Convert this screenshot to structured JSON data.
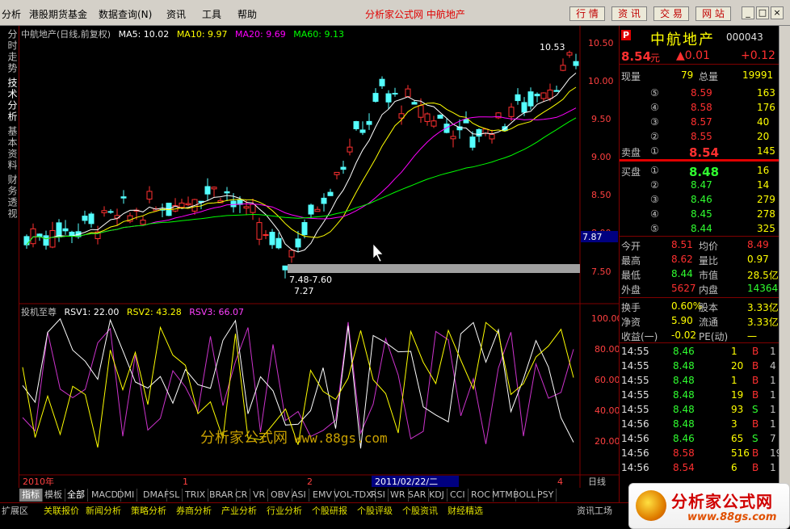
{
  "menu": {
    "items": [
      "分析",
      "港股期货基金",
      "数据查询(N)",
      "资讯",
      "工具",
      "帮助"
    ],
    "title": "分析家公式网  中航地产",
    "buttons": [
      "行 情",
      "资 讯",
      "交 易",
      "网 站"
    ],
    "win_buttons": [
      "_",
      "□",
      "×"
    ]
  },
  "side_tabs": [
    "分时走势",
    "技术分析",
    "基本资料",
    "财务透视"
  ],
  "main_chart": {
    "header": {
      "name": "中航地产(日线,前复权)",
      "ma5": "MA5: 10.02",
      "ma10": "MA10: 9.97",
      "ma20": "MA20: 9.69",
      "ma60": "MA60: 9.13"
    },
    "price_axis": [
      "10.50",
      "10.00",
      "9.50",
      "9.00",
      "8.50",
      "8.00",
      "7.50"
    ],
    "current_marker": "7.87",
    "annot_high": "10.53",
    "annot_range": "7.48-7.60",
    "annot_low": "7.27"
  },
  "indicator": {
    "header": {
      "name": "投机至尊",
      "rsv1": "RSV1: 22.00",
      "rsv2": "RSV2: 43.28",
      "rsv3": "RSV3: 66.07"
    },
    "axis": [
      "100.00",
      "80.00",
      "60.00",
      "40.00",
      "20.00"
    ]
  },
  "time_axis": {
    "year": "2010年",
    "m1": "1",
    "m2": "2",
    "date": "2011/02/22/二",
    "m4": "4",
    "period": "日线"
  },
  "watermark": {
    "cn": "分析家公式网",
    "url": "www.88gs.com"
  },
  "right_panel": {
    "title": "中航地产",
    "code": "000043",
    "badge": "P",
    "price": "8.54",
    "price_unit": "元",
    "change": "▲0.01",
    "change_pct": "+0.12",
    "volume_now_label": "现量",
    "volume_now": "79",
    "volume_total_label": "总量",
    "volume_total": "19991",
    "sell_label": "卖盘",
    "buy_label": "买盘",
    "sells": [
      {
        "lvl": "⑤",
        "price": "8.59",
        "vol": "163"
      },
      {
        "lvl": "④",
        "price": "8.58",
        "vol": "176"
      },
      {
        "lvl": "③",
        "price": "8.57",
        "vol": "40"
      },
      {
        "lvl": "②",
        "price": "8.55",
        "vol": "20"
      },
      {
        "lvl": "①",
        "price": "8.54",
        "vol": "145"
      }
    ],
    "buys": [
      {
        "lvl": "①",
        "price": "8.48",
        "vol": "16"
      },
      {
        "lvl": "②",
        "price": "8.47",
        "vol": "14"
      },
      {
        "lvl": "③",
        "price": "8.46",
        "vol": "279"
      },
      {
        "lvl": "④",
        "price": "8.45",
        "vol": "278"
      },
      {
        "lvl": "⑤",
        "price": "8.44",
        "vol": "325"
      }
    ],
    "stats": [
      {
        "l1": "今开",
        "v1": "8.51",
        "l2": "均价",
        "v2": "8.49"
      },
      {
        "l1": "最高",
        "v1": "8.62",
        "l2": "量比",
        "v2": "0.97"
      },
      {
        "l1": "最低",
        "v1": "8.44",
        "l2": "市值",
        "v2": "28.5亿"
      },
      {
        "l1": "外盘",
        "v1": "5627",
        "l2": "内盘",
        "v2": "14364"
      }
    ],
    "fund": [
      {
        "l1": "换手",
        "v1": "0.60%",
        "l2": "股本",
        "v2": "3.33亿"
      },
      {
        "l1": "净资",
        "v1": "5.90",
        "l2": "流通",
        "v2": "3.33亿"
      },
      {
        "l1": "收益(一)",
        "v1": "-0.02",
        "l2": "PE(动)",
        "v2": "一"
      }
    ],
    "ticks": [
      {
        "t": "14:55",
        "p": "8.46",
        "v": "1",
        "s": "B",
        "n": "1"
      },
      {
        "t": "14:55",
        "p": "8.48",
        "v": "20",
        "s": "B",
        "n": "4"
      },
      {
        "t": "14:55",
        "p": "8.48",
        "v": "1",
        "s": "B",
        "n": "1"
      },
      {
        "t": "14:55",
        "p": "8.48",
        "v": "19",
        "s": "B",
        "n": "1"
      },
      {
        "t": "14:55",
        "p": "8.48",
        "v": "93",
        "s": "S",
        "n": "1"
      },
      {
        "t": "14:56",
        "p": "8.48",
        "v": "3",
        "s": "B",
        "n": "1"
      },
      {
        "t": "14:56",
        "p": "8.46",
        "v": "65",
        "s": "S",
        "n": "7"
      },
      {
        "t": "14:56",
        "p": "8.58",
        "v": "516",
        "s": "B",
        "n": "19"
      },
      {
        "t": "14:56",
        "p": "8.54",
        "v": "6",
        "s": "B",
        "n": "1"
      }
    ]
  },
  "bottom_tabs": [
    "指标",
    "模板",
    "全部",
    "MACD",
    "DMI",
    "DMA",
    "FSL",
    "TRIX",
    "BRAR",
    "CR",
    "VR",
    "OBV",
    "ASI",
    "EMV",
    "VOL-TDX",
    "RSI",
    "WR",
    "SAR",
    "KDJ",
    "CCI",
    "ROC",
    "MTM",
    "BOLL",
    "PSY"
  ],
  "status_tabs": [
    "扩展区",
    "关联报价",
    "新闻分析",
    "策略分析",
    "券商分析",
    "产业分析",
    "行业分析",
    "个股研报",
    "个股评级",
    "个股资讯",
    "财经精选"
  ],
  "status_right": "资讯工场",
  "colors": {
    "up": "#ff3030",
    "down": "#54ffff",
    "ma5": "#ffffff",
    "ma10": "#ffff00",
    "ma20": "#ff00ff",
    "ma60": "#00ff00"
  }
}
